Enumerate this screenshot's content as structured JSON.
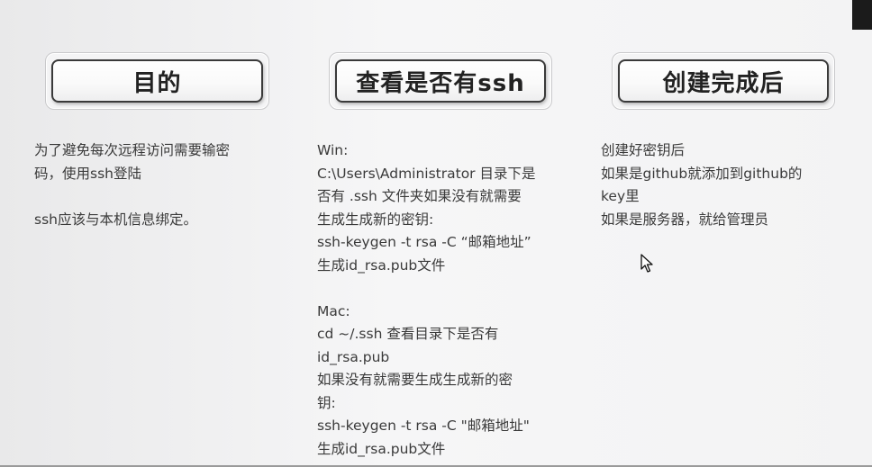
{
  "columns": [
    {
      "heading": "目的",
      "lines": [
        "为了避免每次远程访问需要输密",
        "码，使用ssh登陆",
        "",
        "ssh应该与本机信息绑定。"
      ]
    },
    {
      "heading": "查看是否有ssh",
      "lines": [
        "Win:",
        "C:\\Users\\Administrator 目录下是",
        "否有 .ssh 文件夹如果没有就需要",
        "生成生成新的密钥:",
        "ssh-keygen -t rsa -C “邮箱地址”",
        "生成id_rsa.pub文件",
        "",
        "Mac:",
        "cd ~/.ssh 查看目录下是否有",
        "id_rsa.pub",
        "如果没有就需要生成生成新的密",
        "钥:",
        "ssh-keygen -t rsa -C \"邮箱地址\"",
        "生成id_rsa.pub文件"
      ]
    },
    {
      "heading": "创建完成后",
      "lines": [
        "创建好密钥后",
        "如果是github就添加到github的",
        "key里",
        "如果是服务器，就给管理员"
      ]
    }
  ],
  "cursor": {
    "icon": "mouse-pointer-icon"
  }
}
